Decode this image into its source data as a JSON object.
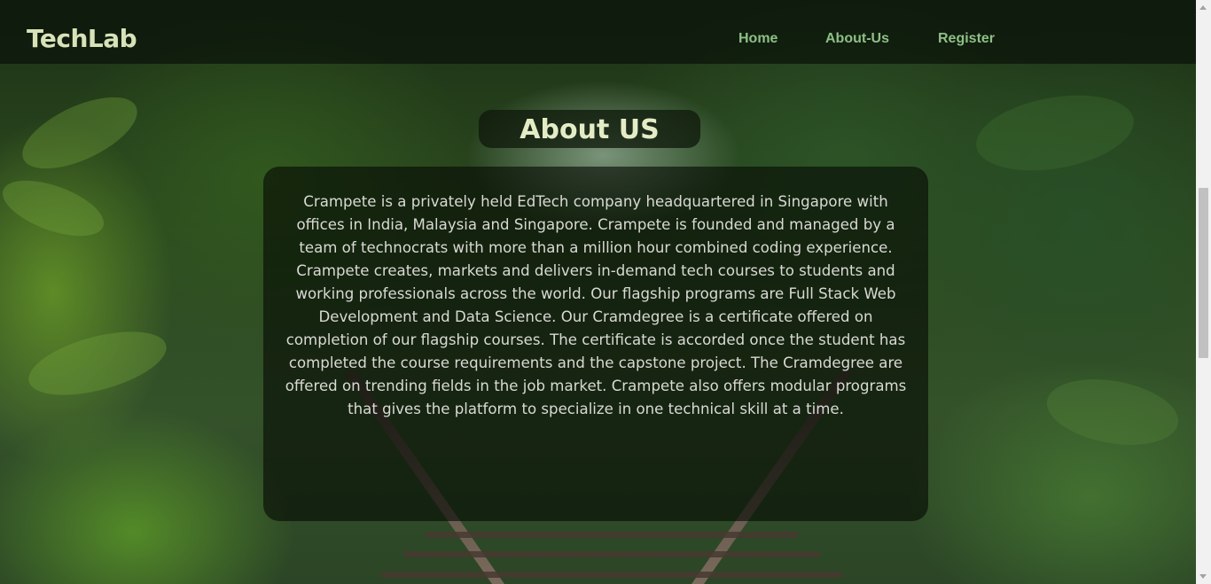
{
  "navbar": {
    "brand": "TechLab",
    "links": [
      "Home",
      "About-Us",
      "Register"
    ]
  },
  "about": {
    "title": "About US",
    "body": "Crampete is a privately held EdTech company headquartered in Singapore with offices in India, Malaysia and Singapore. Crampete is founded and managed by a team of technocrats with more than a million hour combined coding experience. Crampete creates, markets and delivers in-demand tech courses to students and working professionals across the world. Our flagship programs are Full Stack Web Development and Data Science. Our Cramdegree is a certificate offered on completion of our flagship courses. The certificate is accorded once the student has completed the course requirements and the capstone project. The Cramdegree are offered on trending fields in the job market. Crampete also offers modular programs that gives the platform to specialize in one technical skill at a time."
  },
  "colors": {
    "brand_text": "#d8e2b8",
    "nav_link": "#8fbf86",
    "heading_text": "#e4ecc6",
    "body_text": "#d9d9d4"
  },
  "icons": {
    "background": "forest-railway-image"
  }
}
